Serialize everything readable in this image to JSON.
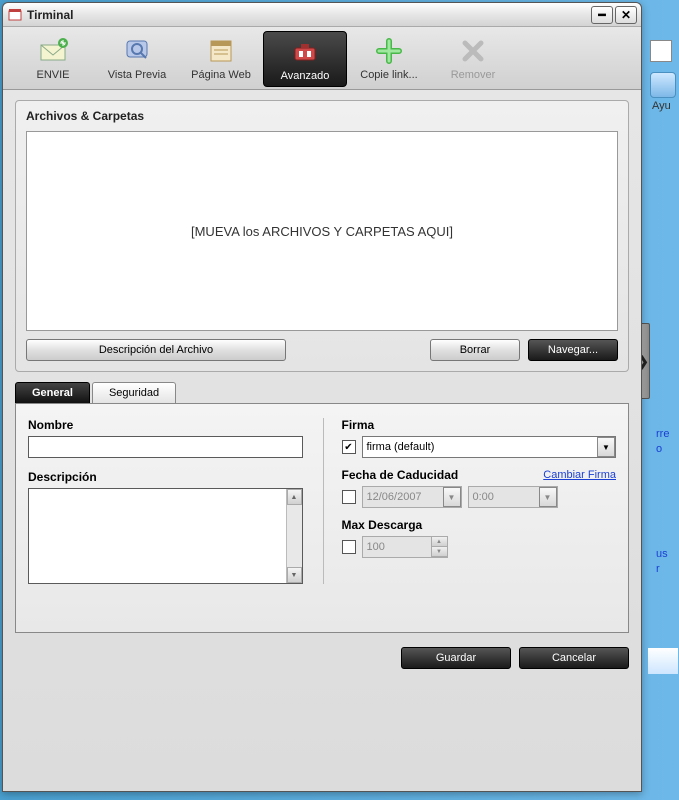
{
  "window": {
    "title": "Tirminal"
  },
  "toolbar": {
    "envie": "ENVIE",
    "vista_previa": "Vista Previa",
    "pagina_web": "Página Web",
    "avanzado": "Avanzado",
    "copie_link": "Copie link...",
    "remover": "Remover"
  },
  "files_group": {
    "title": "Archivos & Carpetas",
    "drop_hint": "[MUEVA los ARCHIVOS Y CARPETAS AQUI]",
    "desc_btn": "Descripción del Archivo",
    "delete_btn": "Borrar",
    "browse_btn": "Navegar..."
  },
  "tabs": {
    "general": "General",
    "seguridad": "Seguridad"
  },
  "form": {
    "nombre_label": "Nombre",
    "nombre_value": "",
    "descripcion_label": "Descripción",
    "descripcion_value": "",
    "firma_label": "Firma",
    "firma_checked": true,
    "firma_value": "firma (default)",
    "cambiar_firma": "Cambiar Firma",
    "caducidad_label": "Fecha de Caducidad",
    "caducidad_checked": false,
    "caducidad_date": "12/06/2007",
    "caducidad_time": "0:00",
    "max_descarga_label": "Max Descarga",
    "max_descarga_checked": false,
    "max_descarga_value": "100"
  },
  "actions": {
    "guardar": "Guardar",
    "cancelar": "Cancelar"
  },
  "collapse_arrow": "❯",
  "bg": {
    "ayuda": "Ayu",
    "frag1": "rre",
    "frag2": "o",
    "frag3": "us",
    "frag4": "r"
  }
}
